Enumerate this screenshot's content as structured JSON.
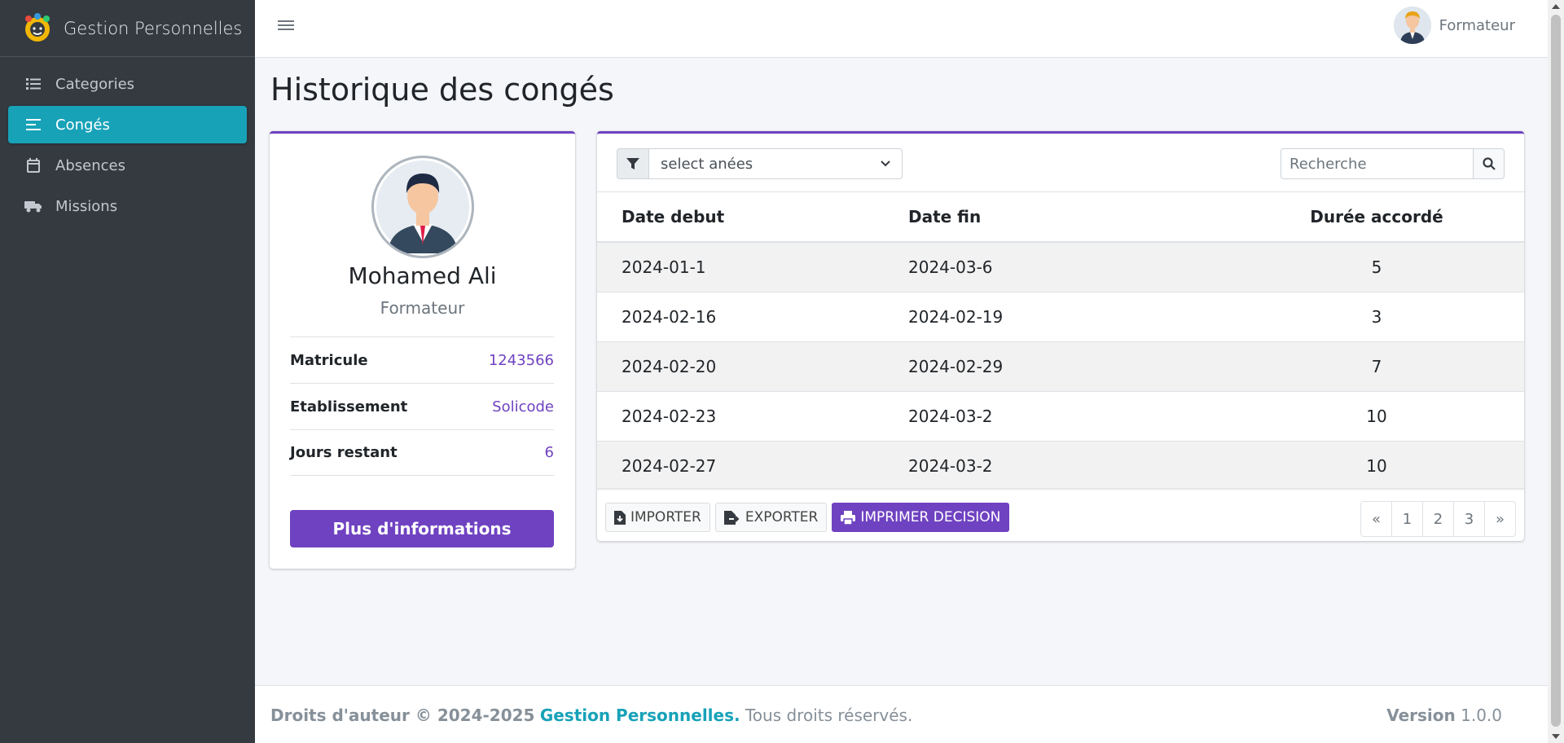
{
  "app": {
    "brand": "Gestion Personnelles"
  },
  "sidebar": {
    "items": [
      {
        "label": "Categories",
        "icon": "list-icon",
        "active": false
      },
      {
        "label": "Congés",
        "icon": "bars-icon",
        "active": true
      },
      {
        "label": "Absences",
        "icon": "calendar-icon",
        "active": false
      },
      {
        "label": "Missions",
        "icon": "truck-icon",
        "active": false
      }
    ]
  },
  "header": {
    "user_label": "Formateur"
  },
  "page": {
    "title": "Historique des congés"
  },
  "profile": {
    "name": "Mohamed Ali",
    "role": "Formateur",
    "info": [
      {
        "label": "Matricule",
        "value": "1243566"
      },
      {
        "label": "Etablissement",
        "value": "Solicode"
      },
      {
        "label": "Jours restant",
        "value": "6"
      }
    ],
    "more_button": "Plus d'informations"
  },
  "table": {
    "filter_select": "select anées",
    "search_placeholder": "Recherche",
    "columns": [
      "Date debut",
      "Date fin",
      "Durée accordé"
    ],
    "rows": [
      [
        "2024-01-1",
        "2024-03-6",
        "5"
      ],
      [
        "2024-02-16",
        "2024-02-19",
        "3"
      ],
      [
        "2024-02-20",
        "2024-02-29",
        "7"
      ],
      [
        "2024-02-23",
        "2024-03-2",
        "10"
      ],
      [
        "2024-02-27",
        "2024-03-2",
        "10"
      ]
    ],
    "actions": {
      "import": "IMPORTER",
      "export": "EXPORTER",
      "print": "IMPRIMER DECISION"
    },
    "pagination": [
      "«",
      "1",
      "2",
      "3",
      "»"
    ]
  },
  "footer": {
    "copyright": "Droits d'auteur © 2024-2025",
    "brand": "Gestion Personnelles.",
    "rights": "Tous droits réservés.",
    "version_label": "Version",
    "version_value": "1.0.0"
  },
  "colors": {
    "primary": "#6f42c1",
    "info": "#17a2b8",
    "sidebar": "#343a40"
  }
}
